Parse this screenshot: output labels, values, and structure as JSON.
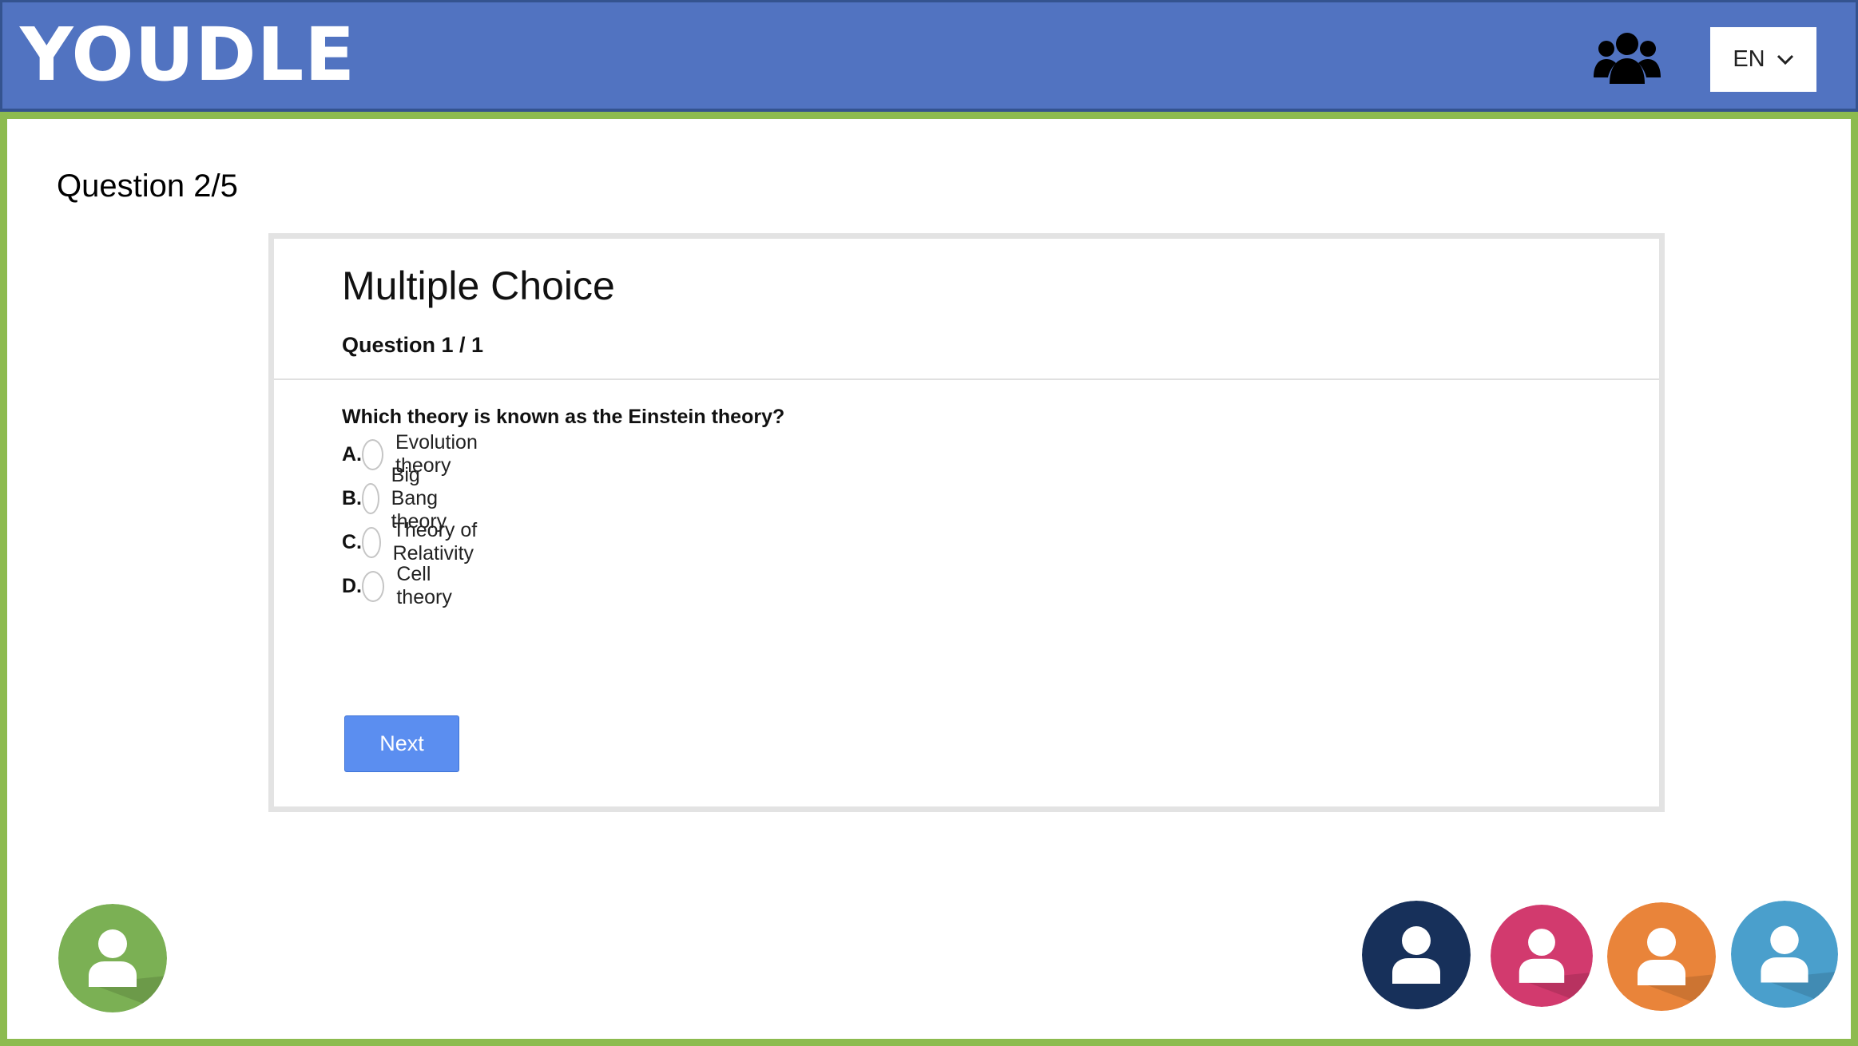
{
  "header": {
    "logo": "YOUDLE",
    "group_icon": "users-group-icon",
    "language": {
      "selected": "EN",
      "icon": "chevron-down-icon"
    }
  },
  "quiz": {
    "counter": "Question 2/5",
    "card": {
      "title": "Multiple Choice",
      "subtitle": "Question 1 / 1",
      "prompt": "Which theory is known as the Einstein theory?",
      "options": [
        {
          "letter": "A.",
          "text": "Evolution theory"
        },
        {
          "letter": "B.",
          "text": "Big Bang theory"
        },
        {
          "letter": "C.",
          "text": "Theory of Relativity"
        },
        {
          "letter": "D.",
          "text": "Cell theory"
        }
      ],
      "next_label": "Next"
    }
  },
  "participants": {
    "self": {
      "color": "#7bb054",
      "icon": "user-avatar-icon"
    },
    "others": [
      {
        "color": "#17305a",
        "icon": "user-avatar-icon"
      },
      {
        "color": "#d23a6e",
        "icon": "user-avatar-icon"
      },
      {
        "color": "#e9843a",
        "icon": "user-avatar-icon"
      },
      {
        "color": "#4a9fcc",
        "icon": "user-avatar-icon"
      }
    ]
  },
  "colors": {
    "header_bg": "#5173c1",
    "frame": "#8dbb4f",
    "next_button": "#5b8ef0"
  }
}
